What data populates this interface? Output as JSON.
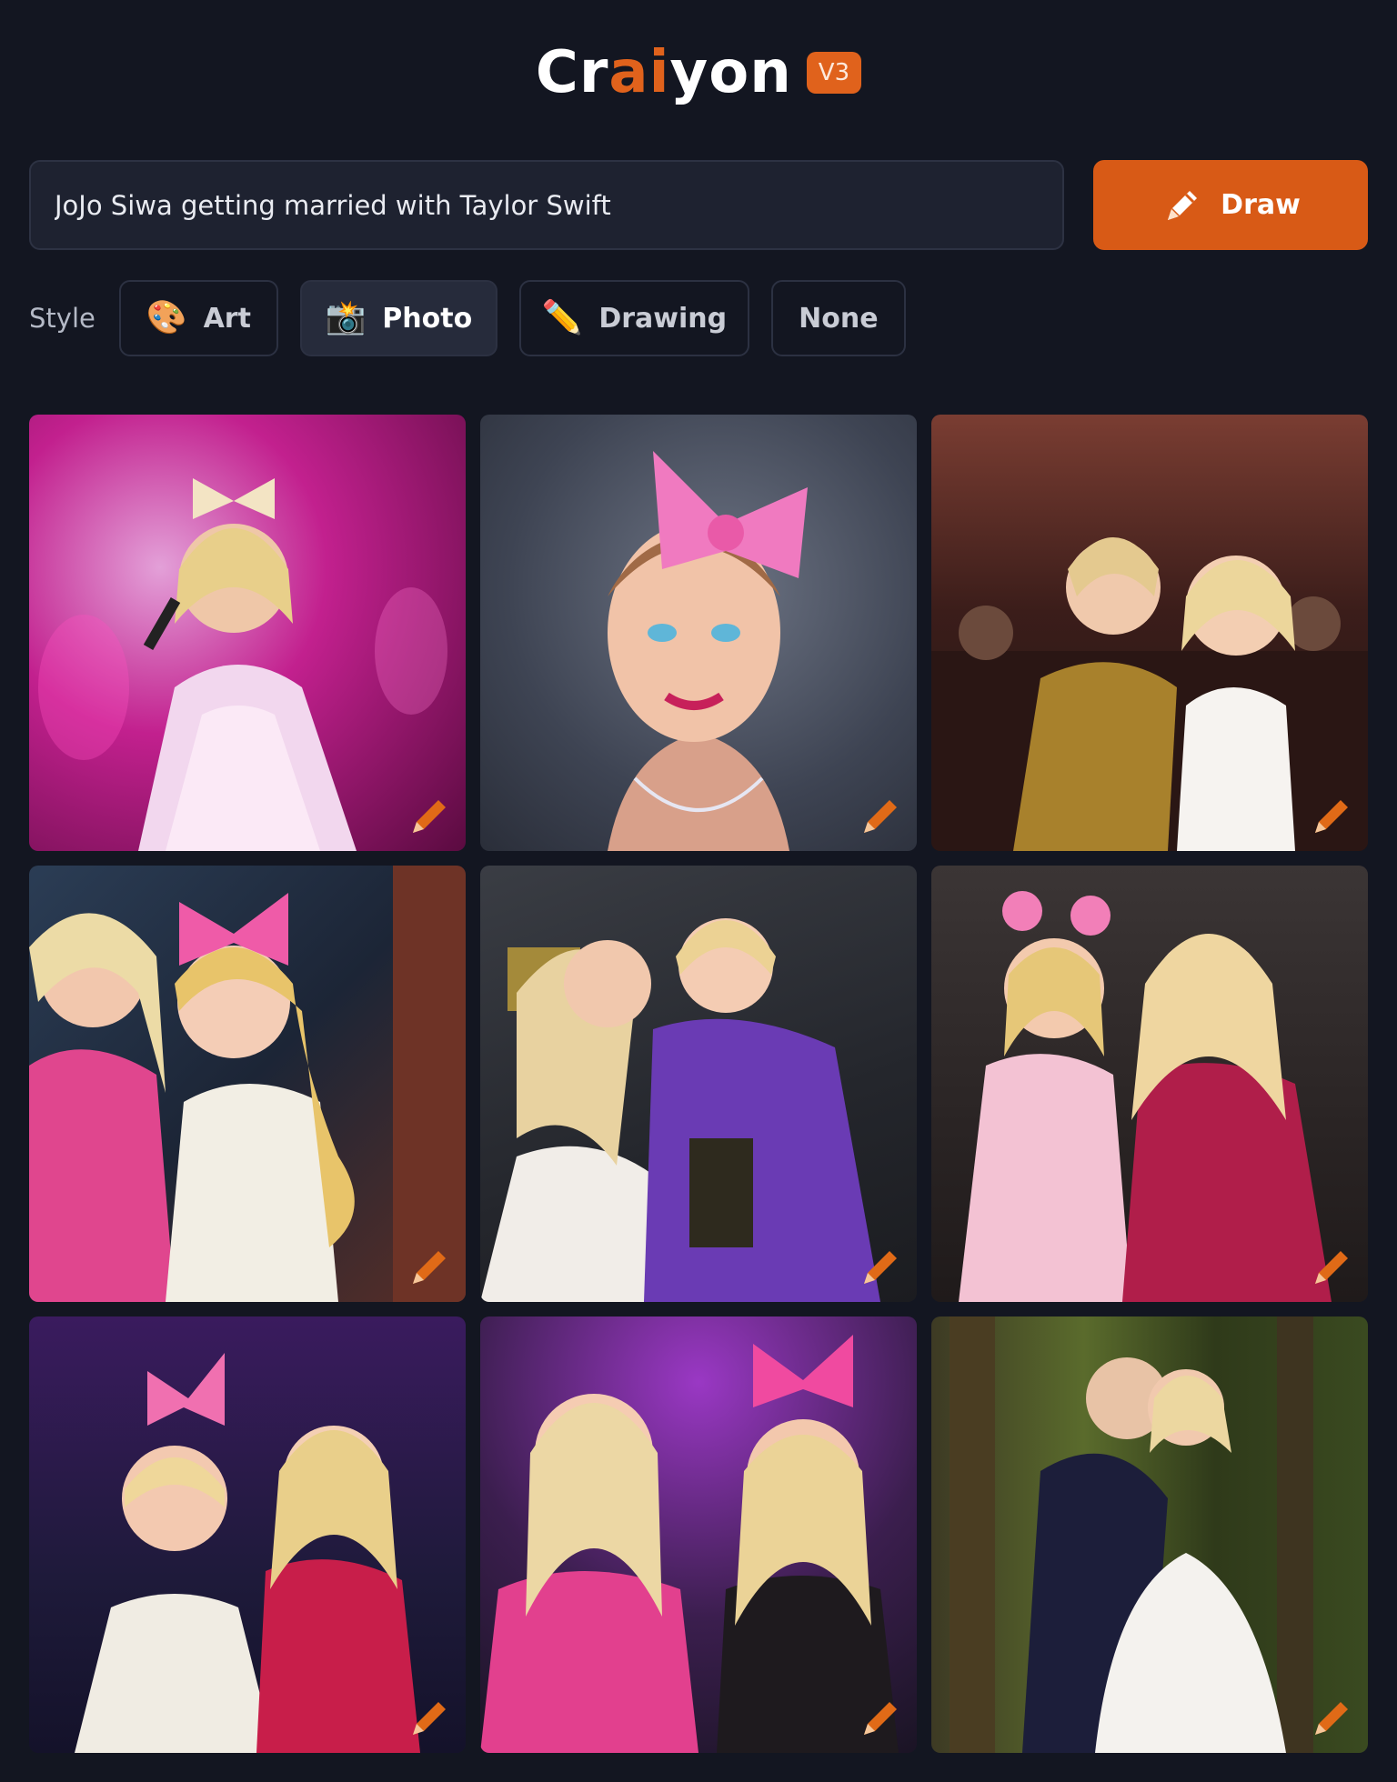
{
  "header": {
    "logo_prefix": "Cr",
    "logo_accent": "ai",
    "logo_suffix": "yon",
    "version": "V3"
  },
  "prompt": {
    "value": "JoJo Siwa getting married with Taylor Swift",
    "draw_label": "Draw"
  },
  "style": {
    "label": "Style",
    "options": [
      {
        "emoji": "🎨",
        "label": "Art",
        "selected": false
      },
      {
        "emoji": "📸",
        "label": "Photo",
        "selected": true
      },
      {
        "emoji": "✏️",
        "label": "Drawing",
        "selected": false
      },
      {
        "emoji": "",
        "label": "None",
        "selected": false
      }
    ]
  },
  "grid": {
    "tile_count": 9,
    "edit_icon": "pencil-icon"
  },
  "colors": {
    "accent": "#d85a16",
    "background": "#131621",
    "input": "#1e2230"
  }
}
